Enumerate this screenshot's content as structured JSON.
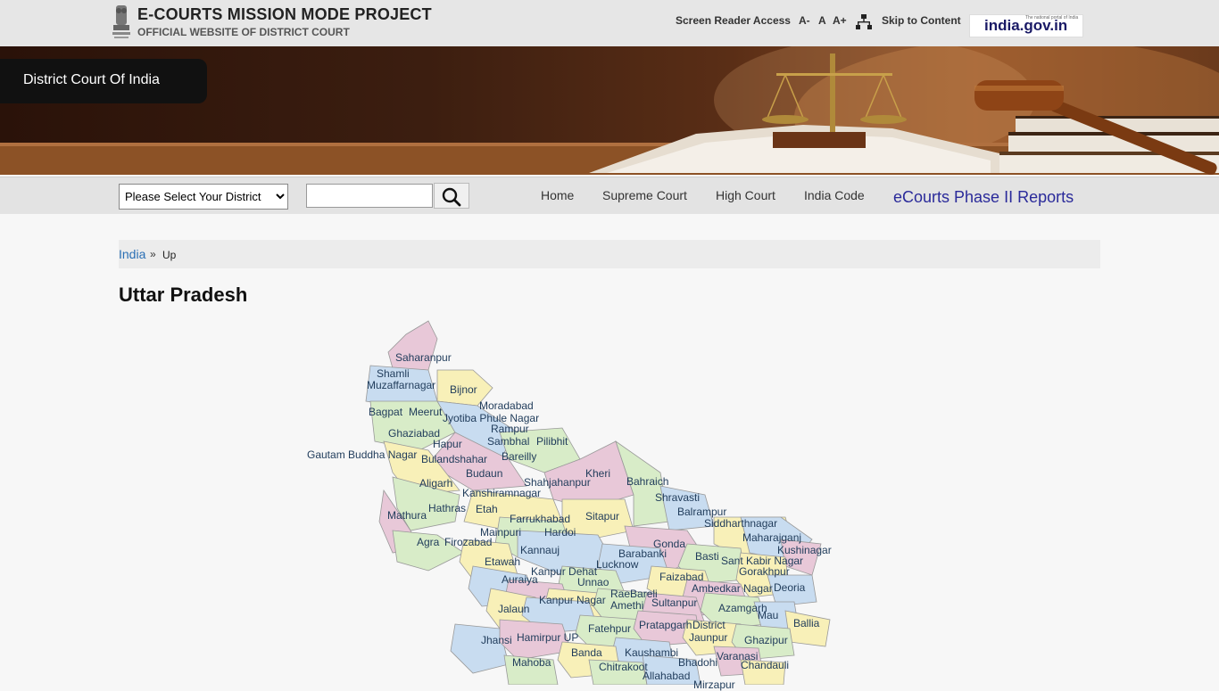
{
  "header": {
    "title": "E-COURTS MISSION MODE PROJECT",
    "subtitle": "OFFICIAL WEBSITE OF DISTRICT COURT",
    "screen_reader": "Screen Reader Access",
    "font_decrease": "A-",
    "font_normal": "A",
    "font_increase": "A+",
    "skip": "Skip to Content",
    "indiagov_logo": "india.gov.in",
    "indiagov_tag": "The national portal of India"
  },
  "banner": {
    "title": "District Court Of India"
  },
  "nav": {
    "district_select_value": "Please Select Your District",
    "home": "Home",
    "supreme": "Supreme Court",
    "high": "High Court",
    "code": "India Code",
    "reports": "eCourts Phase II Reports"
  },
  "breadcrumb": {
    "india": "India",
    "sep": "»",
    "current": "Up"
  },
  "page": {
    "title": "Uttar Pradesh"
  },
  "map": {
    "districts": [
      "Saharanpur",
      "Shamli",
      "Muzaffarnagar",
      "Bijnor",
      "Moradabad",
      "Bagpat",
      "Meerut",
      "Jyotiba Phule Nagar",
      "Ghaziabad",
      "Rampur",
      "Hapur",
      "Sambhal",
      "Pilibhit",
      "Gautam Buddha Nagar",
      "Bulandshahar",
      "Bareilly",
      "Budaun",
      "Kheri",
      "Aligarh",
      "Shahjahanpur",
      "Bahraich",
      "Kanshiramnagar",
      "Shravasti",
      "Mathura",
      "Hathras",
      "Etah",
      "Sitapur",
      "Balrampur",
      "Farrukhabad",
      "Siddharthnagar",
      "Hardoi",
      "Maharajganj",
      "Agra",
      "Firozabad",
      "Mainpuri",
      "Gonda",
      "Kushinagar",
      "Kannauj",
      "Barabanki",
      "Basti",
      "Sant Kabir Nagar",
      "Etawah",
      "Kanpur Dehat",
      "Lucknow",
      "Gorakhpur",
      "Auraiya",
      "Unnao",
      "Faizabad",
      "Deoria",
      "Ambedkar Nagar",
      "RaeBareli",
      "Jalaun",
      "Kanpur Nagar",
      "Amethi",
      "Sultanpur",
      "Azamgarh",
      "Mau",
      "Ballia",
      "Fatehpur",
      "Pratapgarh",
      "District",
      "Jhansi",
      "Hamirpur UP",
      "Jaunpur",
      "Ghazipur",
      "Kaushambi",
      "Banda",
      "Varanasi",
      "Mahoba",
      "Chitrakoot",
      "Bhadohi",
      "Chandauli",
      "Allahabad",
      "Mirzapur"
    ]
  }
}
